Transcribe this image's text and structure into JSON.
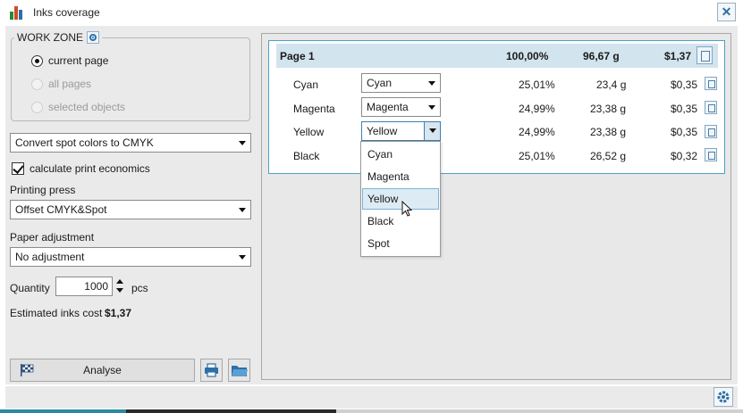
{
  "window": {
    "title": "Inks coverage",
    "close_label": "✕"
  },
  "workzone": {
    "legend": "WORK ZONE",
    "options": [
      {
        "label": "current page",
        "selected": true,
        "enabled": true
      },
      {
        "label": "all pages",
        "selected": false,
        "enabled": false
      },
      {
        "label": "selected objects",
        "selected": false,
        "enabled": false
      }
    ]
  },
  "conversion": {
    "selected": "Convert spot colors to CMYK"
  },
  "economics": {
    "checkbox_label": "calculate print economics",
    "checked": true
  },
  "printing_press": {
    "label": "Printing press",
    "selected": "Offset CMYK&Spot"
  },
  "paper_adjustment": {
    "label": "Paper adjustment",
    "selected": "No adjustment"
  },
  "quantity": {
    "label": "Quantity",
    "value": "1000",
    "unit": "pcs"
  },
  "estimate": {
    "label": "Estimated inks cost",
    "value": "$1,37"
  },
  "actions": {
    "analyse_label": "Analyse"
  },
  "page": {
    "name": "Page 1",
    "coverage": "100,00%",
    "weight": "96,67 g",
    "cost": "$1,37",
    "inks": [
      {
        "name": "Cyan",
        "channel": "Cyan",
        "coverage": "25,01%",
        "weight": "23,4 g",
        "cost": "$0,35"
      },
      {
        "name": "Magenta",
        "channel": "Magenta",
        "coverage": "24,99%",
        "weight": "23,38 g",
        "cost": "$0,35"
      },
      {
        "name": "Yellow",
        "channel": "Yellow",
        "coverage": "24,99%",
        "weight": "23,38 g",
        "cost": "$0,35"
      },
      {
        "name": "Black",
        "channel": "",
        "coverage": "25,01%",
        "weight": "26,52 g",
        "cost": "$0,32"
      }
    ]
  },
  "dropdown": {
    "options": [
      "Cyan",
      "Magenta",
      "Yellow",
      "Black",
      "Spot"
    ],
    "highlighted": "Yellow"
  },
  "colors": {
    "accent": "#2c6fa6",
    "header_bg": "#d2e4ee",
    "panel_border": "#4aa3c8"
  }
}
